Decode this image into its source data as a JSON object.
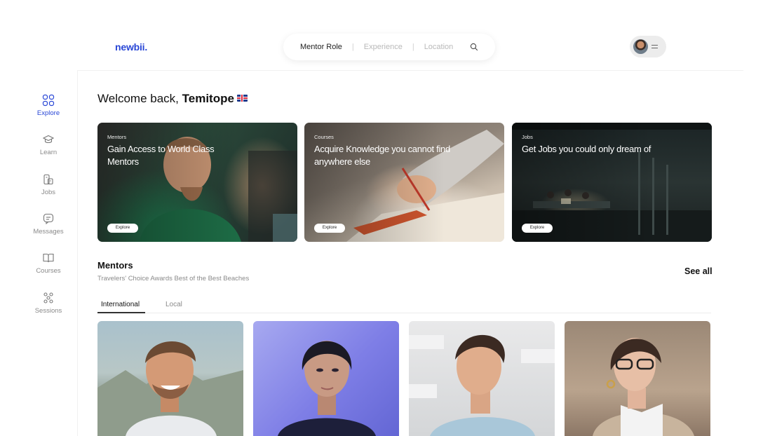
{
  "header": {
    "logo": "newbii.",
    "search": {
      "segments": [
        "Mentor Role",
        "Experience",
        "Location"
      ],
      "separator": "|"
    },
    "icons": {
      "search": "search-icon",
      "menu": "menu-icon"
    }
  },
  "sidebar": {
    "items": [
      {
        "label": "Explore",
        "icon": "grid-icon",
        "active": true
      },
      {
        "label": "Learn",
        "icon": "graduation-cap-icon",
        "active": false
      },
      {
        "label": "Jobs",
        "icon": "briefcase-icon",
        "active": false
      },
      {
        "label": "Messages",
        "icon": "chat-icon",
        "active": false
      },
      {
        "label": "Courses",
        "icon": "book-icon",
        "active": false
      },
      {
        "label": "Sessions",
        "icon": "people-icon",
        "active": false
      }
    ],
    "accent": "#2947d6"
  },
  "welcome": {
    "prefix": "Welcome back, ",
    "name": "Temitope",
    "flag": "uk-flag-icon"
  },
  "cards": [
    {
      "kicker": "Mentors",
      "headline": "Gain Access to World Class Mentors",
      "button": "Explore"
    },
    {
      "kicker": "Courses",
      "headline": "Acquire Knowledge you cannot find anywhere else",
      "button": "Explore"
    },
    {
      "kicker": "Jobs",
      "headline": "Get Jobs you could only dream of",
      "button": "Explore"
    }
  ],
  "mentors_section": {
    "title": "Mentors",
    "subtitle": "Travelers' Choice Awards Best of the Best Beaches",
    "see_all": "See all",
    "tabs": [
      {
        "label": "International",
        "active": true
      },
      {
        "label": "Local",
        "active": false
      }
    ]
  }
}
